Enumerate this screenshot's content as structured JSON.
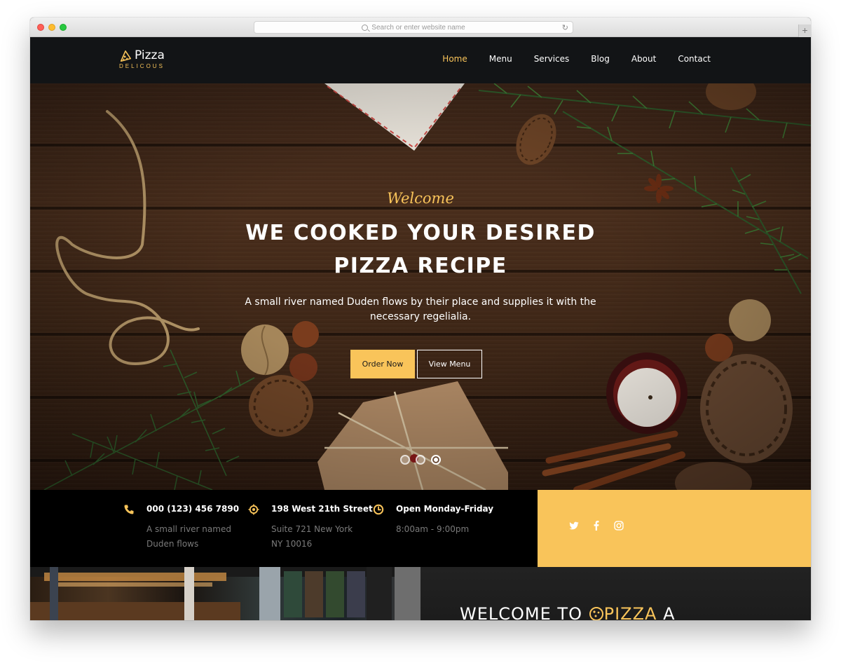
{
  "browser": {
    "address_placeholder": "Search or enter website name"
  },
  "brand": {
    "name": "Pizza",
    "tagline": "DELICOUS",
    "accent_color": "#f9c45a"
  },
  "nav": {
    "items": [
      {
        "label": "Home",
        "active": true
      },
      {
        "label": "Menu",
        "active": false
      },
      {
        "label": "Services",
        "active": false
      },
      {
        "label": "Blog",
        "active": false
      },
      {
        "label": "About",
        "active": false
      },
      {
        "label": "Contact",
        "active": false
      }
    ]
  },
  "hero": {
    "welcome": "Welcome",
    "headline_line1": "WE COOKED YOUR DESIRED",
    "headline_line2": "PIZZA RECIPE",
    "subtext": "A small river named Duden flows by their place and supplies it with the necessary regelialia.",
    "primary_button": "Order Now",
    "secondary_button": "View Menu",
    "slides": 3,
    "active_slide": 3
  },
  "info": [
    {
      "icon": "phone-icon",
      "title": "000 (123) 456 7890",
      "desc": "A small river named Duden flows"
    },
    {
      "icon": "location-icon",
      "title": "198 West 21th Street",
      "desc": "Suite 721 New York NY 10016"
    },
    {
      "icon": "clock-icon",
      "title": "Open Monday-Friday",
      "desc": "8:00am - 9:00pm"
    }
  ],
  "social": [
    "twitter-icon",
    "facebook-icon",
    "instagram-icon"
  ],
  "welcome_section": {
    "prefix": "WELCOME TO",
    "brand": "PIZZA",
    "suffix": "A"
  }
}
